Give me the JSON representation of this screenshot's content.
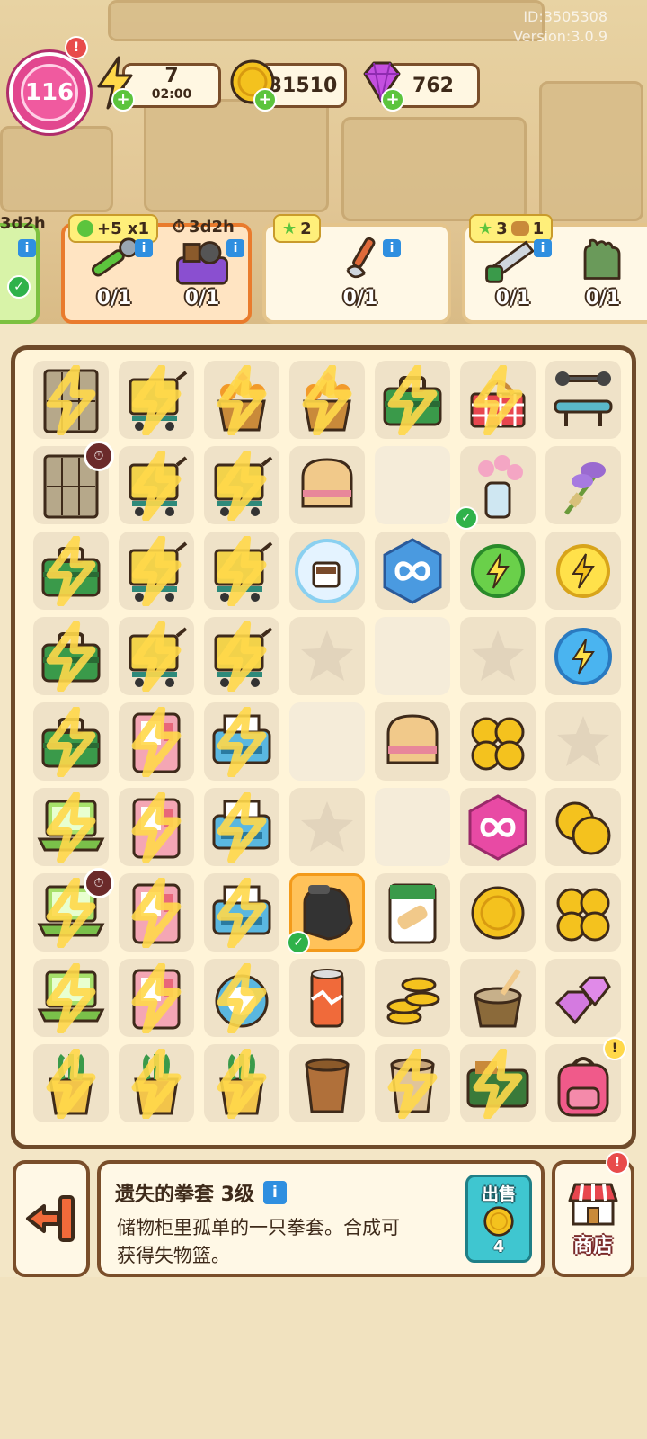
{
  "meta": {
    "id_text": "ID:3505308",
    "version_text": "Version:3.0.9"
  },
  "hud": {
    "level": "116",
    "energy": {
      "value": "7",
      "timer": "02:00"
    },
    "coins": "31510",
    "gems": "762"
  },
  "orders": [
    {
      "badge": "3d2h",
      "items": [
        {
          "count": "",
          "icon": "flower-vase-icon"
        }
      ],
      "state": "done"
    },
    {
      "badge_boost": "+5 x1",
      "badge_timer": "3d2h",
      "items": [
        {
          "count": "0/1",
          "icon": "wrench-icon"
        },
        {
          "count": "0/1",
          "icon": "purple-basket-icon"
        }
      ],
      "state": "active"
    },
    {
      "badge": "2",
      "items": [
        {
          "count": "0/1",
          "icon": "pliers-icon"
        }
      ]
    },
    {
      "badge": "3",
      "badge_extra": "1",
      "items": [
        {
          "count": "0/1",
          "icon": "saw-icon"
        },
        {
          "count": "0/1",
          "icon": "glove-icon"
        }
      ]
    }
  ],
  "board": {
    "rows": [
      [
        "locker",
        "cart",
        "flower-basket",
        "flower-basket",
        "toolbox",
        "picnic-basket",
        "bench"
      ],
      [
        "locker",
        "cart",
        "cart",
        "toast",
        "",
        "flower-vase",
        "lavender"
      ],
      [
        "toolbox",
        "cart",
        "cart",
        "coffee-bubble",
        "infinity-blue",
        "energy-green",
        "energy-yellow"
      ],
      [
        "toolbox",
        "cart",
        "cart",
        "star",
        "",
        "star",
        "energy-blue"
      ],
      [
        "toolbox",
        "vending",
        "printer",
        "",
        "toast",
        "coins",
        "star"
      ],
      [
        "laptop",
        "vending",
        "printer",
        "star",
        "",
        "infinity-pink",
        "coins-2"
      ],
      [
        "laptop",
        "vending",
        "printer",
        "glove",
        "bandage",
        "coin",
        "coins"
      ],
      [
        "laptop",
        "vending",
        "robot-vacuum",
        "soda",
        "coins-stack",
        "mortar",
        "gems"
      ],
      [
        "pot",
        "pot",
        "pot",
        "cup",
        "cup-lock",
        "tool-case",
        "backpack"
      ]
    ],
    "locked": [
      [
        0,
        0
      ],
      [
        0,
        1
      ],
      [
        0,
        2
      ],
      [
        0,
        3
      ],
      [
        0,
        4
      ],
      [
        0,
        5
      ],
      [
        1,
        1
      ],
      [
        1,
        2
      ],
      [
        2,
        0
      ],
      [
        2,
        1
      ],
      [
        2,
        2
      ],
      [
        3,
        0
      ],
      [
        3,
        1
      ],
      [
        3,
        2
      ],
      [
        4,
        0
      ],
      [
        4,
        1
      ],
      [
        4,
        2
      ],
      [
        5,
        0
      ],
      [
        5,
        1
      ],
      [
        5,
        2
      ],
      [
        6,
        0
      ],
      [
        6,
        1
      ],
      [
        6,
        2
      ],
      [
        7,
        0
      ],
      [
        7,
        1
      ],
      [
        7,
        2
      ],
      [
        8,
        0
      ],
      [
        8,
        1
      ],
      [
        8,
        2
      ],
      [
        8,
        4
      ],
      [
        8,
        5
      ]
    ],
    "selected": [
      6,
      3
    ]
  },
  "info": {
    "title": "遗失的拳套 3级",
    "desc": "储物柜里孤单的一只拳套。合成可获得失物篮。",
    "sell_label": "出售",
    "sell_price": "4"
  },
  "shop": {
    "label": "商店"
  },
  "colors": {
    "accent": "#e97b2d",
    "board_border": "#6e4a2a",
    "lock_yellow": "#ffd84a"
  }
}
